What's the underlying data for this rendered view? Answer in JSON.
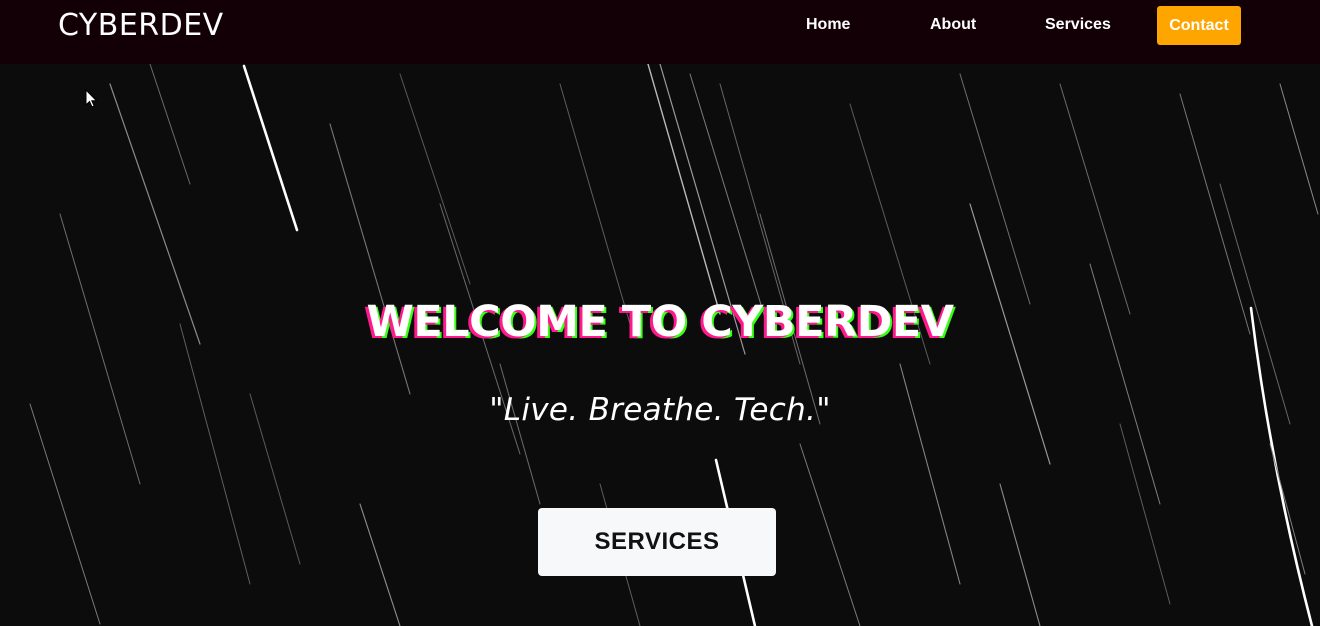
{
  "brand": "CYBERDEV",
  "nav": {
    "items": [
      {
        "label": "Home"
      },
      {
        "label": "About"
      },
      {
        "label": "Services"
      }
    ],
    "contact_label": "Contact"
  },
  "hero": {
    "title": "WELCOME TO CYBERDEV",
    "tagline": "\"Live. Breathe. Tech.\"",
    "button_label": "SERVICES"
  },
  "colors": {
    "navbar_bg": "#130007",
    "accent": "#ffa500",
    "hero_bg": "#0c0c0c",
    "button_bg": "#f7f8f9",
    "title_shadow_pink": "#ff1a8c",
    "title_shadow_green": "#39ff14"
  },
  "icons": {
    "cursor": "arrow-cursor-icon"
  }
}
